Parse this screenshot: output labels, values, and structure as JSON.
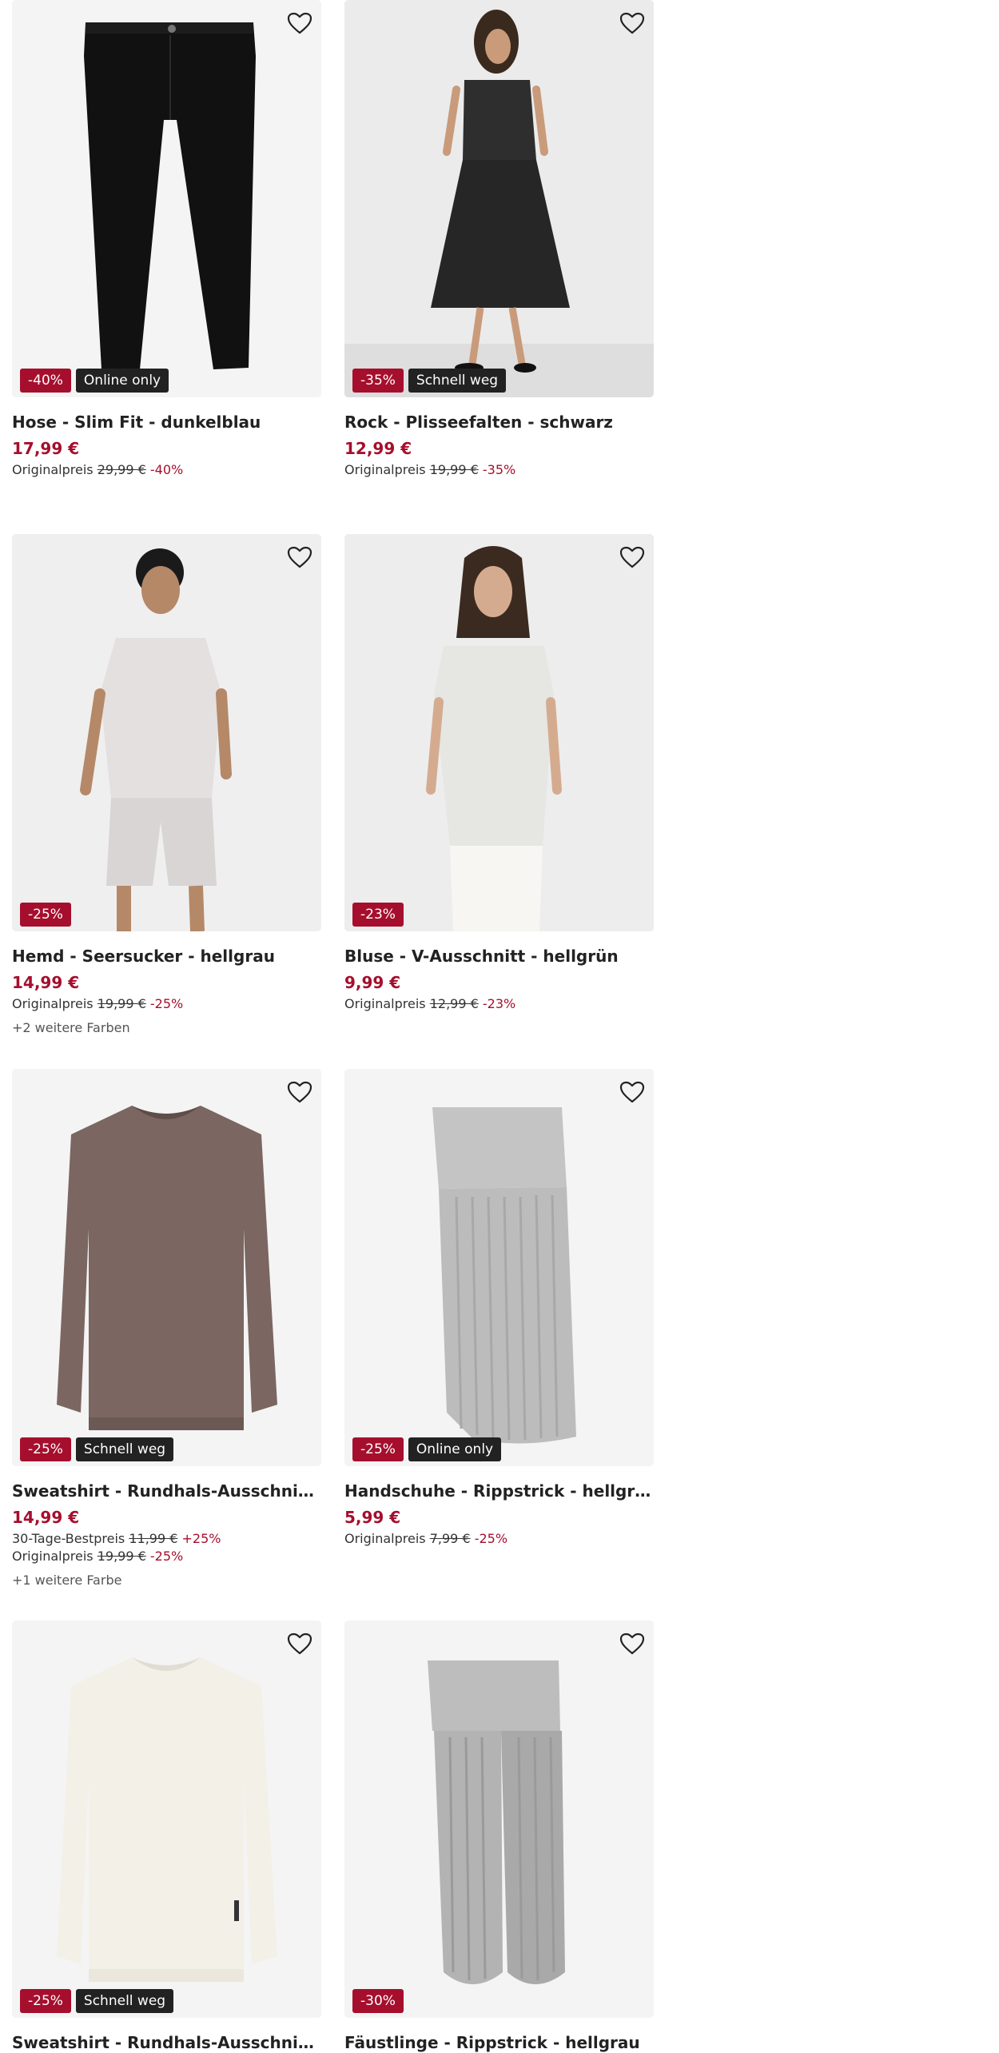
{
  "ui": {
    "colors": {
      "sale": "#a50f2d",
      "dark_badge": "#222222",
      "card_bg": "#f3f3f3"
    },
    "wishlist_icon": "heart-outline-icon"
  },
  "products": [
    {
      "title": "Hose - Slim Fit - dunkelblau",
      "price": "17,99 €",
      "badges": {
        "sale": "-40%",
        "info": "Online only"
      },
      "ref_label": "Originalpreis",
      "ref_price": "29,99 €",
      "ref_pct": "-40%",
      "image": "black-slim-trousers"
    },
    {
      "title": "Rock - Plisseefalten - schwarz",
      "price": "12,99 €",
      "badges": {
        "sale": "-35%",
        "info": "Schnell weg"
      },
      "ref_label": "Originalpreis",
      "ref_price": "19,99 €",
      "ref_pct": "-35%",
      "image": "woman-in-black-pleated-skirt"
    },
    {
      "title": "Hemd - Seersucker - hellgrau",
      "price": "14,99 €",
      "badges": {
        "sale": "-25%"
      },
      "ref_label": "Originalpreis",
      "ref_price": "19,99 €",
      "ref_pct": "-25%",
      "more_colors": "+2 weitere Farben",
      "image": "man-in-light-grey-shirt"
    },
    {
      "title": "Bluse - V-Ausschnitt - hellgrün",
      "price": "9,99 €",
      "badges": {
        "sale": "-23%"
      },
      "ref_label": "Originalpreis",
      "ref_price": "12,99 €",
      "ref_pct": "-23%",
      "image": "woman-in-light-blouse"
    },
    {
      "title": "Sweatshirt - Rundhals-Ausschnitt - hellbraun",
      "price": "14,99 €",
      "badges": {
        "sale": "-25%",
        "info": "Schnell weg"
      },
      "best_label": "30-Tage-Bestpreis",
      "best_price": "11,99 €",
      "best_pct": "+25%",
      "ref_label": "Originalpreis",
      "ref_price": "19,99 €",
      "ref_pct": "-25%",
      "more_colors": "+1 weitere Farbe",
      "image": "brown-sweatshirt"
    },
    {
      "title": "Handschuhe - Rippstrick - hellgrau",
      "price": "5,99 €",
      "badges": {
        "sale": "-25%",
        "info": "Online only"
      },
      "ref_label": "Originalpreis",
      "ref_price": "7,99 €",
      "ref_pct": "-25%",
      "image": "grey-rib-knit-arm-warmer"
    },
    {
      "title": "Sweatshirt - Rundhals-Ausschnitt - weiß",
      "badges": {
        "sale": "-25%",
        "info": "Schnell weg"
      },
      "image": "white-sweatshirt"
    },
    {
      "title": "Fäustlinge - Rippstrick - hellgrau",
      "badges": {
        "sale": "-30%"
      },
      "image": "grey-rib-knit-mittens"
    }
  ]
}
